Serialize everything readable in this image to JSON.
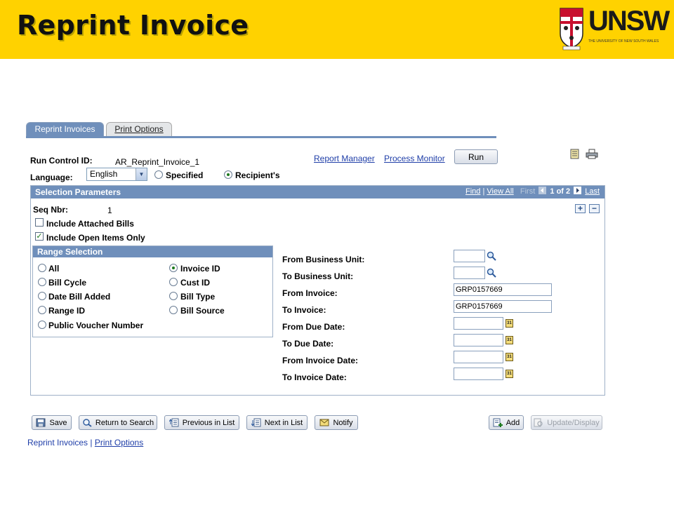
{
  "banner": {
    "title": "Reprint Invoice",
    "logo_name": "UNSW",
    "logo_subtitle": "THE UNIVERSITY OF NEW SOUTH WALES",
    "color": "#ffd200"
  },
  "tabs": [
    {
      "label": "Reprint Invoices",
      "active": true
    },
    {
      "label": "Print Options",
      "active": false
    }
  ],
  "run_control": {
    "label": "Run Control ID:",
    "value": "AR_Reprint_Invoice_1"
  },
  "links": {
    "report_manager": "Report Manager",
    "process_monitor": "Process Monitor"
  },
  "run_button": "Run",
  "language": {
    "label": "Language:",
    "selected": "English",
    "options": [
      {
        "label": "Specified",
        "checked": false
      },
      {
        "label": "Recipient's",
        "checked": true
      }
    ]
  },
  "selection_parameters": {
    "title": "Selection Parameters",
    "nav": {
      "find": "Find",
      "view_all": "View All",
      "first": "First",
      "position": "1 of 2",
      "last": "Last"
    },
    "seq_label": "Seq Nbr:",
    "seq_value": "1",
    "checkboxes": [
      {
        "label": "Include Attached Bills",
        "checked": false
      },
      {
        "label": "Include Open Items Only",
        "checked": true
      }
    ]
  },
  "range_selection": {
    "title": "Range Selection",
    "left": [
      {
        "label": "All",
        "checked": false
      },
      {
        "label": "Bill Cycle",
        "checked": false
      },
      {
        "label": "Date Bill Added",
        "checked": false
      },
      {
        "label": "Range ID",
        "checked": false
      },
      {
        "label": "Public Voucher Number",
        "checked": false
      }
    ],
    "right": [
      {
        "label": "Invoice ID",
        "checked": true
      },
      {
        "label": "Cust ID",
        "checked": false
      },
      {
        "label": "Bill Type",
        "checked": false
      },
      {
        "label": "Bill Source",
        "checked": false
      }
    ]
  },
  "fields": [
    {
      "label": "From Business Unit:",
      "value": "",
      "kind": "lookup"
    },
    {
      "label": "To Business Unit:",
      "value": "",
      "kind": "lookup"
    },
    {
      "label": "From Invoice:",
      "value": "GRP0157669",
      "kind": "text"
    },
    {
      "label": "To Invoice:",
      "value": "GRP0157669",
      "kind": "text"
    },
    {
      "label": "From Due Date:",
      "value": "",
      "kind": "date"
    },
    {
      "label": "To Due Date:",
      "value": "",
      "kind": "date"
    },
    {
      "label": "From Invoice Date:",
      "value": "",
      "kind": "date"
    },
    {
      "label": "To Invoice Date:",
      "value": "",
      "kind": "date"
    }
  ],
  "calendar_icon_text": "31",
  "toolbar": {
    "save": "Save",
    "return_to_search": "Return to Search",
    "previous_in_list": "Previous in List",
    "next_in_list": "Next in List",
    "notify": "Notify",
    "add": "Add",
    "update_display": "Update/Display"
  },
  "footer": {
    "current": "Reprint Invoices",
    "separator": "|",
    "other": "Print Options"
  }
}
